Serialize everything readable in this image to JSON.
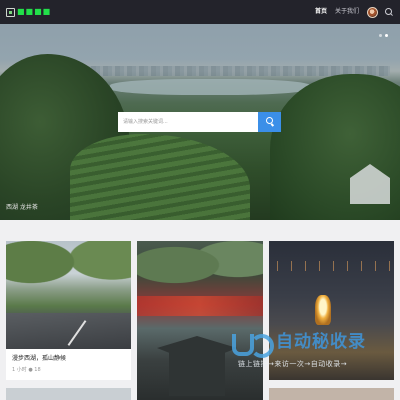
{
  "header": {
    "logo_text": "■■■■",
    "nav": [
      {
        "label": "首页",
        "active": true
      },
      {
        "label": "关于我们",
        "active": false
      }
    ]
  },
  "hero": {
    "search": {
      "placeholder": "请输入搜索关键词..."
    },
    "caption": "西湖 龙井茶",
    "slides": 2,
    "active_slide": 2
  },
  "cards": [
    {
      "title": "漫步西湖，孤山静候",
      "meta": "1 小时 ● 18"
    },
    {
      "title": "",
      "meta": ""
    },
    {
      "title": "",
      "meta": ""
    }
  ],
  "watermark": {
    "brand": "自动秘收录",
    "tagline": "链上链接→来访一次→自动收录→"
  },
  "colors": {
    "topbar": "#23232b",
    "logo": "#22e04a",
    "search_button": "#3b8fe8",
    "page_bg": "#f0f0f2"
  }
}
